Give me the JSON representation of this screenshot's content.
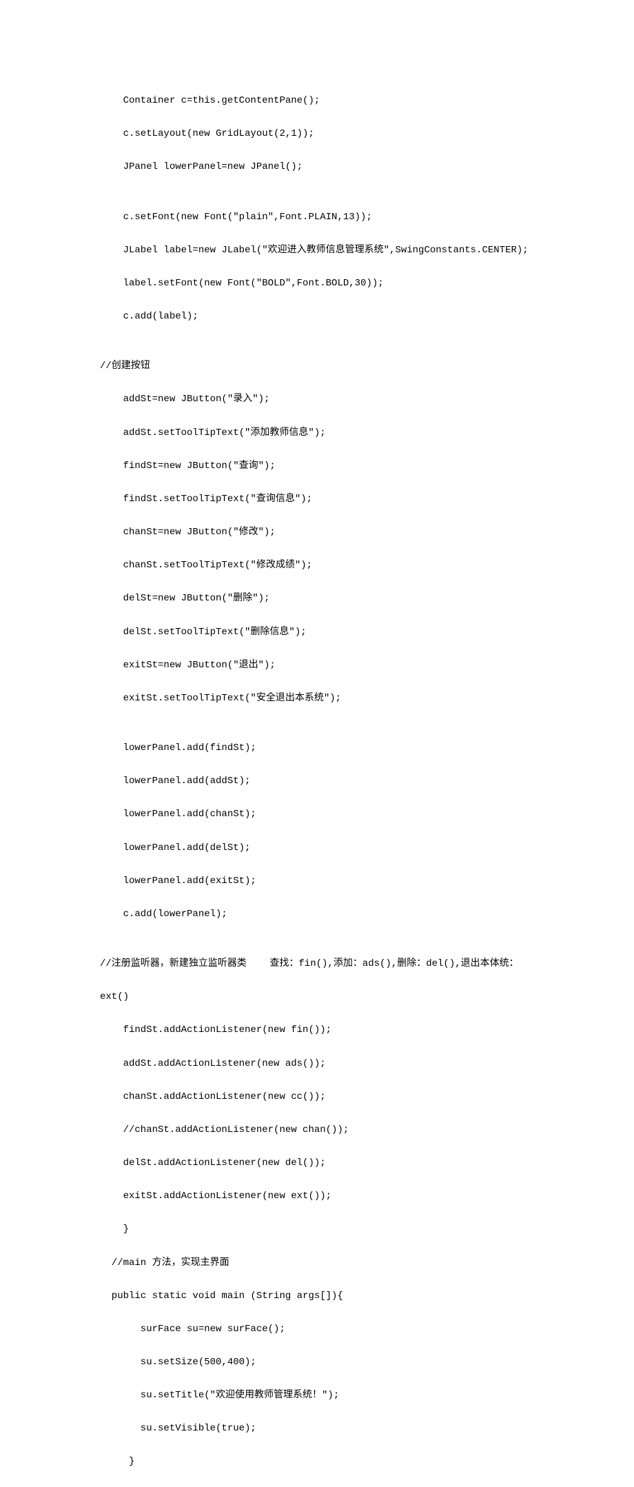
{
  "lines": [
    "    Container c=this.getContentPane();",
    "    c.setLayout(new GridLayout(2,1));",
    "    JPanel lowerPanel=new JPanel();",
    "",
    "    c.setFont(new Font(\"plain\",Font.PLAIN,13));",
    "    JLabel label=new JLabel(\"欢迎进入教师信息管理系统\",SwingConstants.CENTER);",
    "    label.setFont(new Font(\"BOLD\",Font.BOLD,30));",
    "    c.add(label);",
    "",
    "//创建按钮",
    "    addSt=new JButton(\"录入\");",
    "    addSt.setToolTipText(\"添加教师信息\");",
    "    findSt=new JButton(\"查询\");",
    "    findSt.setToolTipText(\"查询信息\");",
    "    chanSt=new JButton(\"修改\");",
    "    chanSt.setToolTipText(\"修改成绩\");",
    "    delSt=new JButton(\"删除\");",
    "    delSt.setToolTipText(\"删除信息\");",
    "    exitSt=new JButton(\"退出\");",
    "    exitSt.setToolTipText(\"安全退出本系统\");",
    "",
    "    lowerPanel.add(findSt);",
    "    lowerPanel.add(addSt);",
    "    lowerPanel.add(chanSt);",
    "    lowerPanel.add(delSt);",
    "    lowerPanel.add(exitSt);",
    "    c.add(lowerPanel);",
    "",
    "//注册监听器，新建独立监听器类    查找：fin(),添加：ads(),删除：del(),退出本体统：",
    "ext()",
    "    findSt.addActionListener(new fin());",
    "    addSt.addActionListener(new ads());",
    "    chanSt.addActionListener(new cc());",
    "    //chanSt.addActionListener(new chan());",
    "    delSt.addActionListener(new del());",
    "    exitSt.addActionListener(new ext());",
    "    }",
    "  //main 方法，实现主界面",
    "  public static void main (String args[]){",
    "       surFace su=new surFace();",
    "       su.setSize(500,400);",
    "       su.setTitle(\"欢迎使用教师管理系统！\");",
    "       su.setVisible(true);",
    "     }"
  ]
}
